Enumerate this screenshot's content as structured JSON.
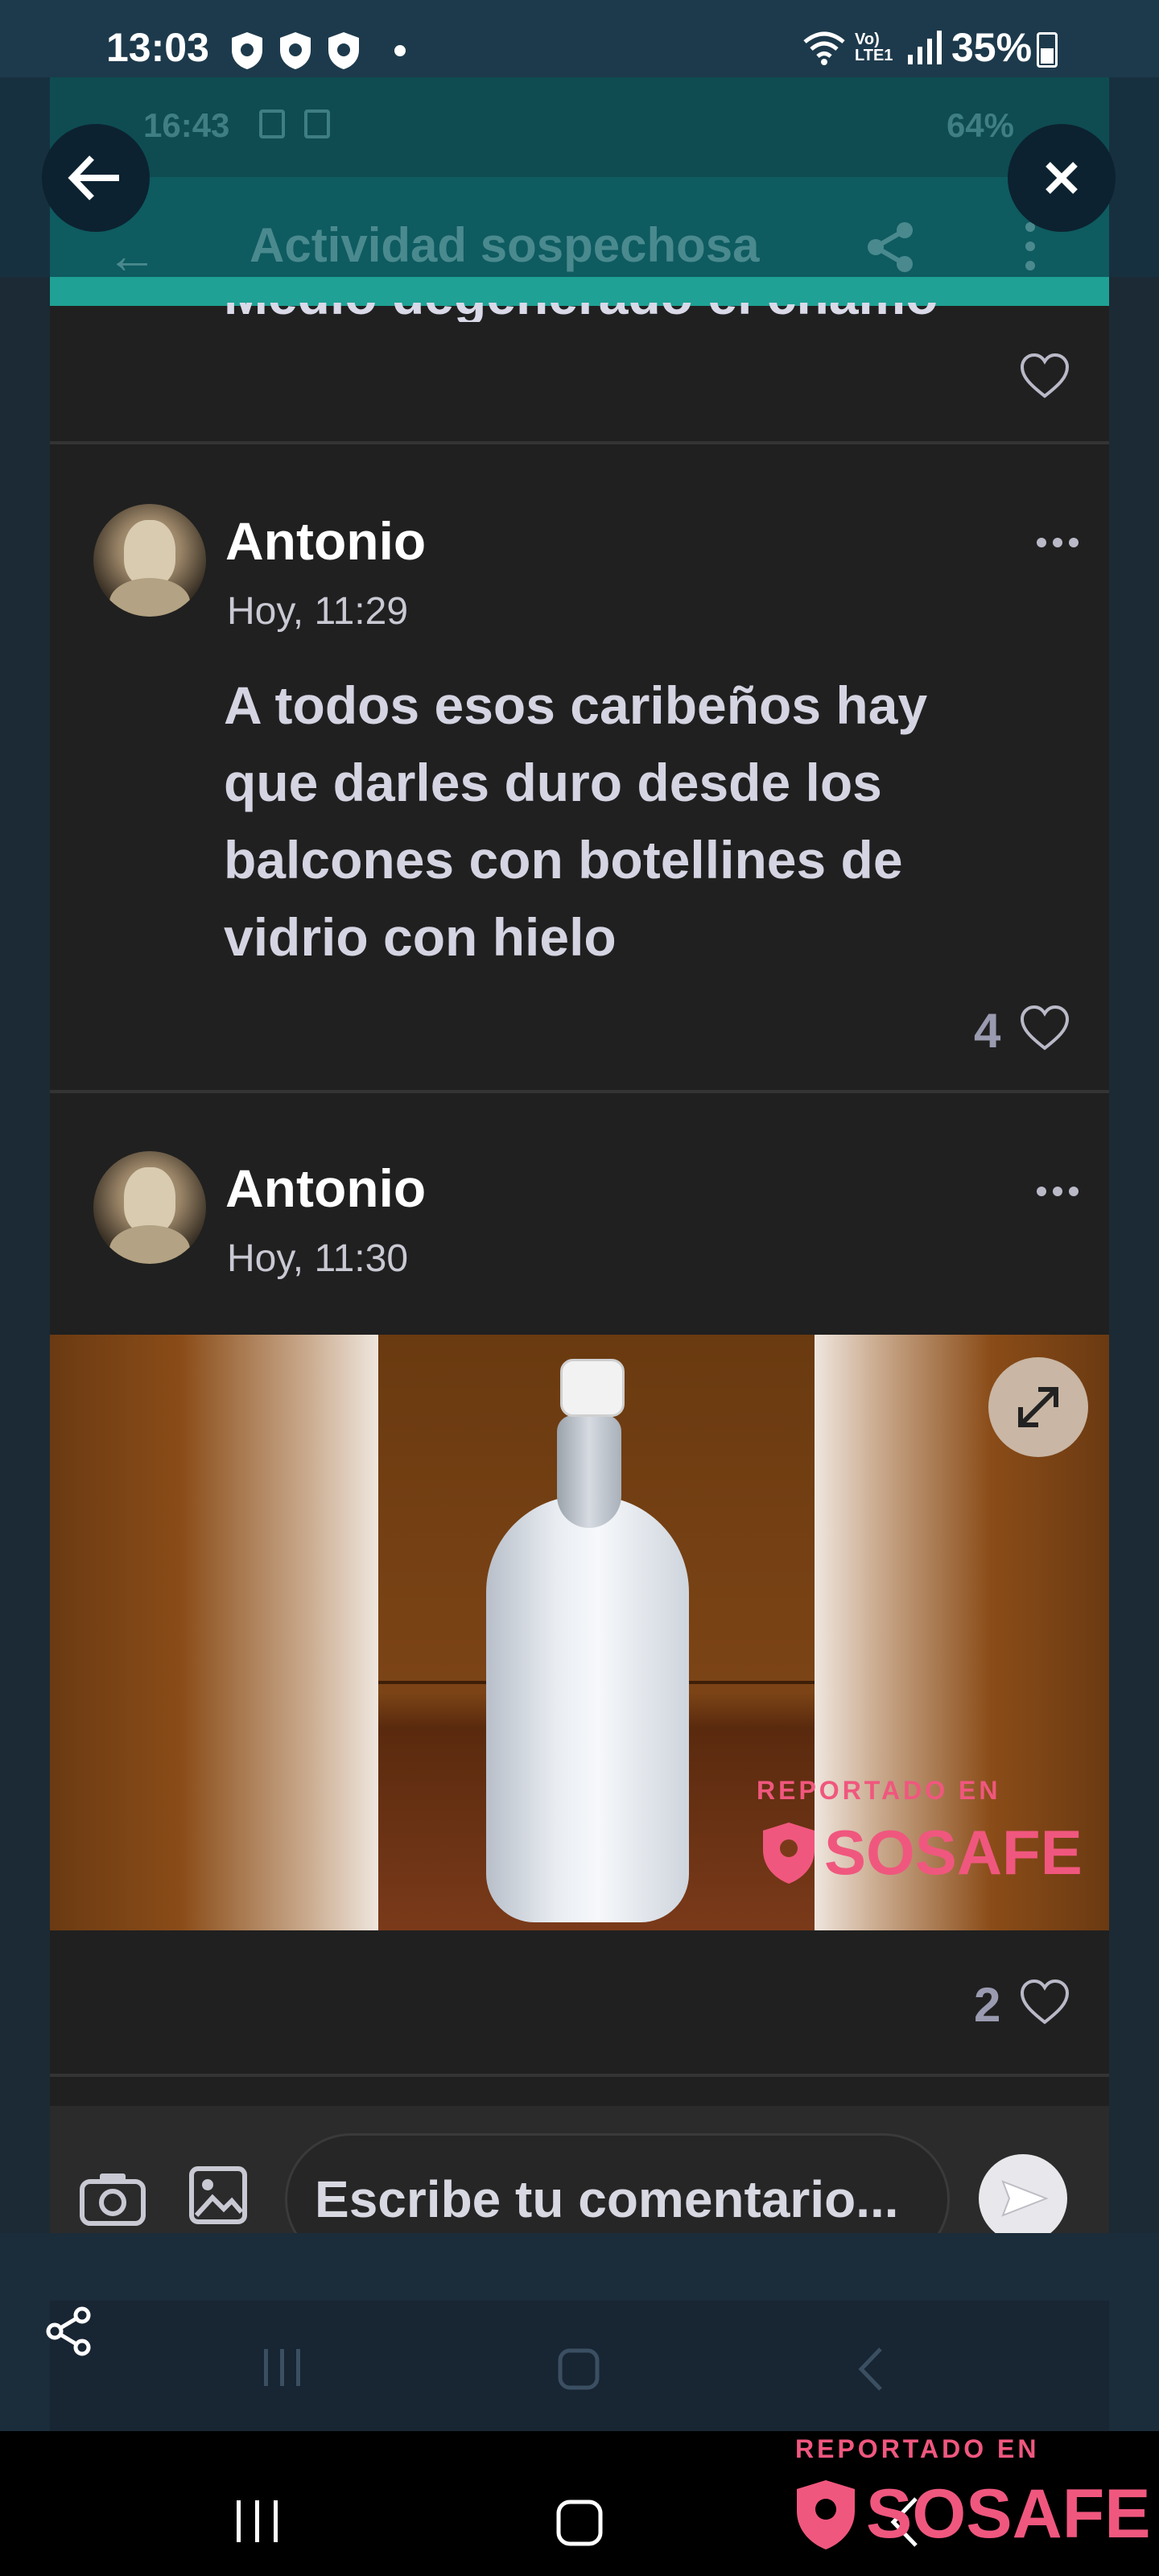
{
  "outer_status": {
    "time": "13:03",
    "network_label": "Vo) LTE1",
    "battery": "35%"
  },
  "inner_status": {
    "time": "16:43",
    "battery": "64%"
  },
  "app_bar": {
    "title": "Actividad sospechosa"
  },
  "previous_post": {
    "partial_text": "Medio degenerado el chamo"
  },
  "posts": [
    {
      "author": "Antonio",
      "time": "Hoy, 11:29",
      "text": "A todos esos caribeños hay que darles duro desde los balcones con botellines de vidrio con hielo",
      "likes": "4"
    },
    {
      "author": "Antonio",
      "time": "Hoy, 11:30",
      "likes": "2",
      "image_watermark_small": "REPORTADO EN",
      "image_watermark_brand": "SOSAFE"
    }
  ],
  "comment": {
    "placeholder": "Escribe tu comentario..."
  },
  "footer_watermark": {
    "small": "REPORTADO EN",
    "brand": "SOSAFE"
  },
  "colors": {
    "accent": "#1fa195",
    "brand": "#f0577e",
    "appbar": "#0e5b60"
  }
}
